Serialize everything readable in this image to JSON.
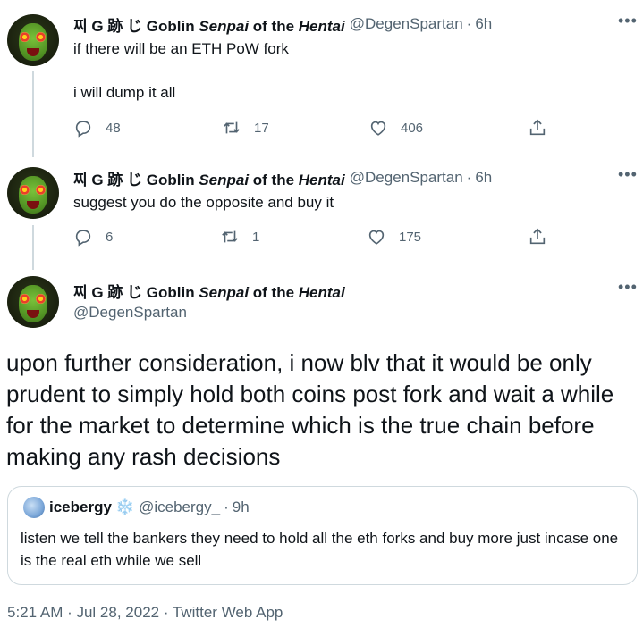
{
  "tweets": [
    {
      "display_name_prefix": "찌 G 跡 じ Goblin ",
      "display_name_italic1": "Senpai",
      "display_name_mid": " of the ",
      "display_name_italic2": "Hentai",
      "handle": "@DegenSpartan",
      "sep": "·",
      "time": "6h",
      "text_line1": "if there will be an ETH PoW fork",
      "text_line2": "i will dump it all",
      "replies": "48",
      "retweets": "17",
      "likes": "406"
    },
    {
      "display_name_prefix": "찌 G 跡 じ Goblin ",
      "display_name_italic1": "Senpai",
      "display_name_mid": " of the ",
      "display_name_italic2": "Hentai",
      "handle": "@DegenSpartan",
      "sep": "·",
      "time": "6h",
      "text_line1": "suggest you do the opposite and buy it",
      "replies": "6",
      "retweets": "1",
      "likes": "175"
    }
  ],
  "main_tweet": {
    "display_name_prefix": "찌 G 跡 じ Goblin ",
    "display_name_italic1": "Senpai",
    "display_name_mid": " of the ",
    "display_name_italic2": "Hentai",
    "handle": "@DegenSpartan",
    "text": "upon further consideration, i now blv that it would be only prudent to simply hold both coins post fork and wait a while for the market to determine which is the true chain before making any rash decisions",
    "quote": {
      "name": "icebergy",
      "emoji": "❄️",
      "handle": "@icebergy_",
      "sep": "·",
      "time": "9h",
      "text": "listen we tell the bankers they need to hold all the eth forks and buy more just incase one is the real eth while we sell"
    },
    "footer": "5:21 AM · Jul 28, 2022 · Twitter Web App"
  },
  "icons": {
    "more": "more-icon",
    "reply": "reply-icon",
    "retweet": "retweet-icon",
    "like": "like-icon",
    "share": "share-icon"
  }
}
